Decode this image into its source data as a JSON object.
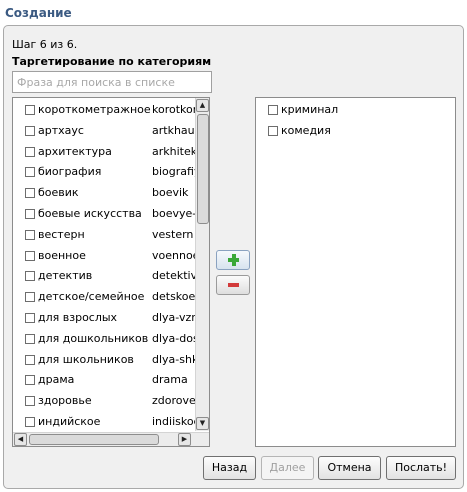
{
  "window": {
    "title": "Создание"
  },
  "wizard": {
    "step_text": "Шаг 6 из 6.",
    "heading": "Таргетирование по категориям",
    "search_placeholder": "Фраза для поиска в списке"
  },
  "available": [
    {
      "name": "короткометражное",
      "slug": "korotkometrazhnoe"
    },
    {
      "name": "артхаус",
      "slug": "artkhaus"
    },
    {
      "name": "архитектура",
      "slug": "arkhitektura"
    },
    {
      "name": "биография",
      "slug": "biografiya"
    },
    {
      "name": "боевик",
      "slug": "boevik"
    },
    {
      "name": "боевые искусства",
      "slug": "boevye-iskusstva"
    },
    {
      "name": "вестерн",
      "slug": "vestern"
    },
    {
      "name": "военное",
      "slug": "voennoe"
    },
    {
      "name": "детектив",
      "slug": "detektiv"
    },
    {
      "name": "детское/семейное",
      "slug": "detskoe"
    },
    {
      "name": "для взрослых",
      "slug": "dlya-vzroslykh"
    },
    {
      "name": "для дошкольников",
      "slug": "dlya-doshkolnikov"
    },
    {
      "name": "для школьников",
      "slug": "dlya-shkolnikov"
    },
    {
      "name": "драма",
      "slug": "drama"
    },
    {
      "name": "здоровье",
      "slug": "zdorove"
    },
    {
      "name": "индийское",
      "slug": "indiiskoe"
    }
  ],
  "selected": [
    {
      "name": "криминал"
    },
    {
      "name": "комедия"
    }
  ],
  "buttons": {
    "back": "Назад",
    "next": "Далее",
    "cancel": "Отмена",
    "send": "Послать!"
  },
  "colors": {
    "title": "#3b5a82",
    "add": "#3aa838",
    "remove": "#d23a3a"
  }
}
